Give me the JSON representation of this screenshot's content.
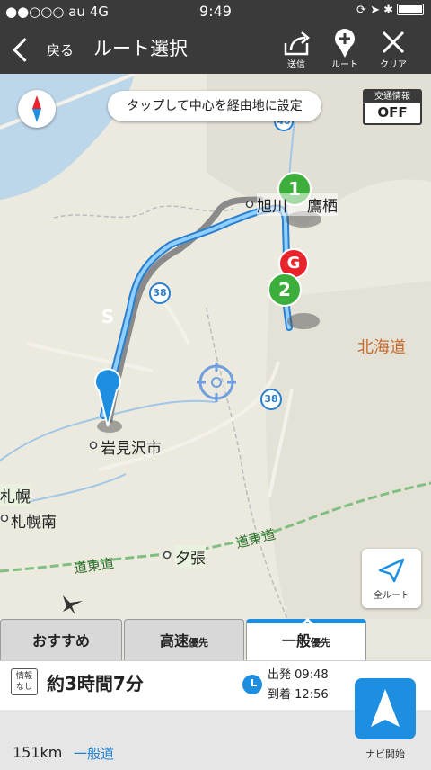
{
  "status": {
    "carrier": "●●○○○ au",
    "network": "4G",
    "time": "9:49"
  },
  "nav": {
    "back_label": "戻る",
    "title": "ルート選択",
    "share_label": "送信",
    "route_label": "ルート",
    "clear_label": "クリア"
  },
  "map": {
    "hint": "タップして中心を経由地に設定",
    "traffic_label": "交通情報",
    "traffic_value": "OFF",
    "full_route_label": "全ルート",
    "labels": {
      "asahikawa": "旭川",
      "takasu": "鷹栖",
      "iwamizawa": "岩見沢市",
      "sapporo": "札幌",
      "sapporo_minami": "札幌南",
      "yubari": "夕張",
      "doto1": "道東道",
      "doto2": "道東道",
      "hokkaido": "北海道",
      "route38a": "38",
      "route38b": "38",
      "route40": "40"
    },
    "markers": {
      "start": "S",
      "wp1": "1",
      "goal": "G",
      "wp2": "2"
    }
  },
  "tabs": [
    {
      "label": "おすすめ",
      "suffix": ""
    },
    {
      "label": "高速",
      "suffix": "優先"
    },
    {
      "label": "一般",
      "suffix": "優先"
    }
  ],
  "summary": {
    "badge_line1": "情報",
    "badge_line2": "なし",
    "duration": "約3時間7分",
    "depart_label": "出発",
    "depart_time": "09:48",
    "arrive_label": "到着",
    "arrive_time": "12:56",
    "distance": "151km",
    "road_type": "一般道",
    "navi_label": "ナビ開始"
  },
  "colors": {
    "accent": "#1e8fe0",
    "bar": "#3a3a3a",
    "route": "#48a8f0",
    "goal": "#e8232b",
    "waypoint": "#3cae3c"
  }
}
